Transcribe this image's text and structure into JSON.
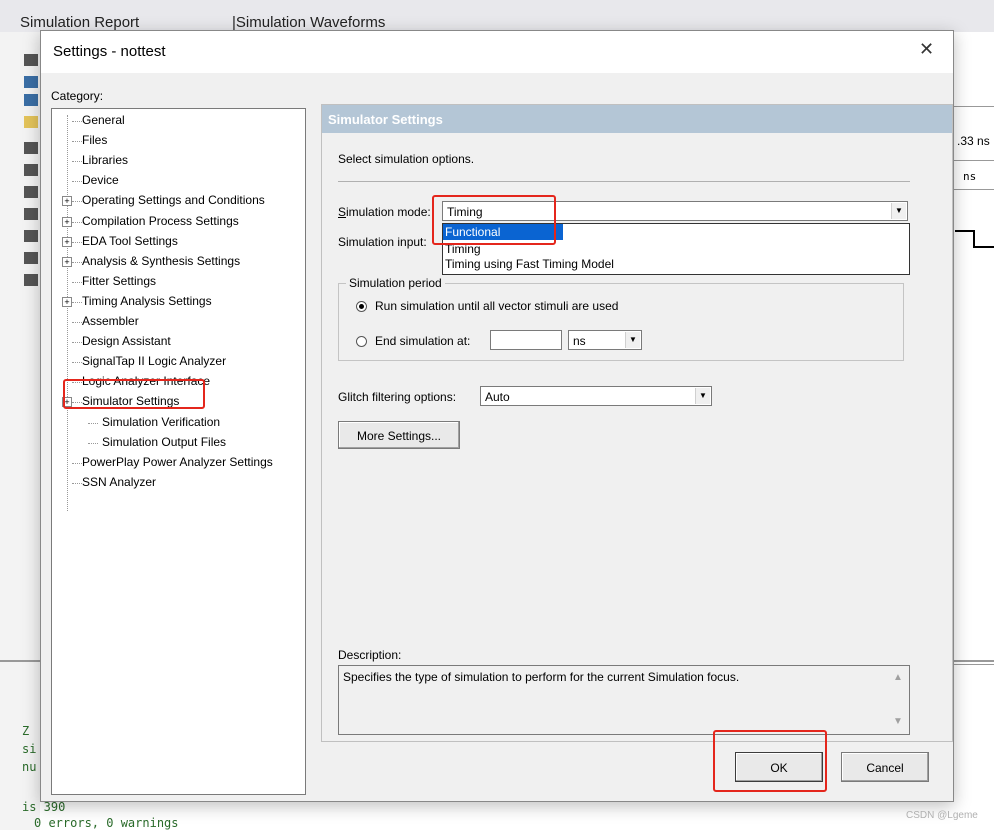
{
  "background": {
    "tab1": "Simulation Report",
    "tab2": "Simulation Waveforms",
    "right_value1": ".33 ns",
    "right_value2": "ns",
    "log_line1": "is 390",
    "log_line2": "0 errors, 0 warnings",
    "log_fragment1": "Z",
    "log_fragment2": "si",
    "log_fragment3": "nu"
  },
  "dialog": {
    "title": "Settings - nottest",
    "category_label": "Category:",
    "tree": [
      {
        "label": "General",
        "expandable": false
      },
      {
        "label": "Files",
        "expandable": false
      },
      {
        "label": "Libraries",
        "expandable": false
      },
      {
        "label": "Device",
        "expandable": false
      },
      {
        "label": "Operating Settings and Conditions",
        "expandable": true
      },
      {
        "label": "Compilation Process Settings",
        "expandable": true
      },
      {
        "label": "EDA Tool Settings",
        "expandable": true
      },
      {
        "label": "Analysis & Synthesis Settings",
        "expandable": true
      },
      {
        "label": "Fitter Settings",
        "expandable": false
      },
      {
        "label": "Timing Analysis Settings",
        "expandable": true
      },
      {
        "label": "Assembler",
        "expandable": false
      },
      {
        "label": "Design Assistant",
        "expandable": false
      },
      {
        "label": "SignalTap II Logic Analyzer",
        "expandable": false
      },
      {
        "label": "Logic Analyzer Interface",
        "expandable": false
      },
      {
        "label": "Simulator Settings",
        "expandable": true,
        "selected": true
      },
      {
        "label": "Simulation Verification",
        "child": true
      },
      {
        "label": "Simulation Output Files",
        "child": true
      },
      {
        "label": "PowerPlay Power Analyzer Settings",
        "expandable": false
      },
      {
        "label": "SSN Analyzer",
        "expandable": false
      }
    ],
    "panel_title": "Simulator Settings",
    "intro": "Select simulation options.",
    "sim_mode_label": "Simulation mode:",
    "sim_mode_value": "Timing",
    "sim_input_label": "Simulation input:",
    "sim_mode_options": [
      "Functional",
      "Timing",
      "Timing using Fast Timing Model"
    ],
    "sim_mode_highlighted": "Functional",
    "period_group_label": "Simulation period",
    "radio_run_all": "Run simulation until all vector stimuli are used",
    "radio_end_at": "End simulation at:",
    "end_at_value": "",
    "end_at_unit": "ns",
    "glitch_label": "Glitch filtering options:",
    "glitch_value": "Auto",
    "more_settings": "More Settings...",
    "description_label": "Description:",
    "description_text": "Specifies the type of simulation to perform for the current Simulation focus.",
    "ok": "OK",
    "cancel": "Cancel"
  },
  "watermark": "CSDN @Lgeme",
  "colors": {
    "panel_header": "#b4c6d6",
    "selection": "#0a64d2",
    "annotation_red": "#e4261c"
  }
}
